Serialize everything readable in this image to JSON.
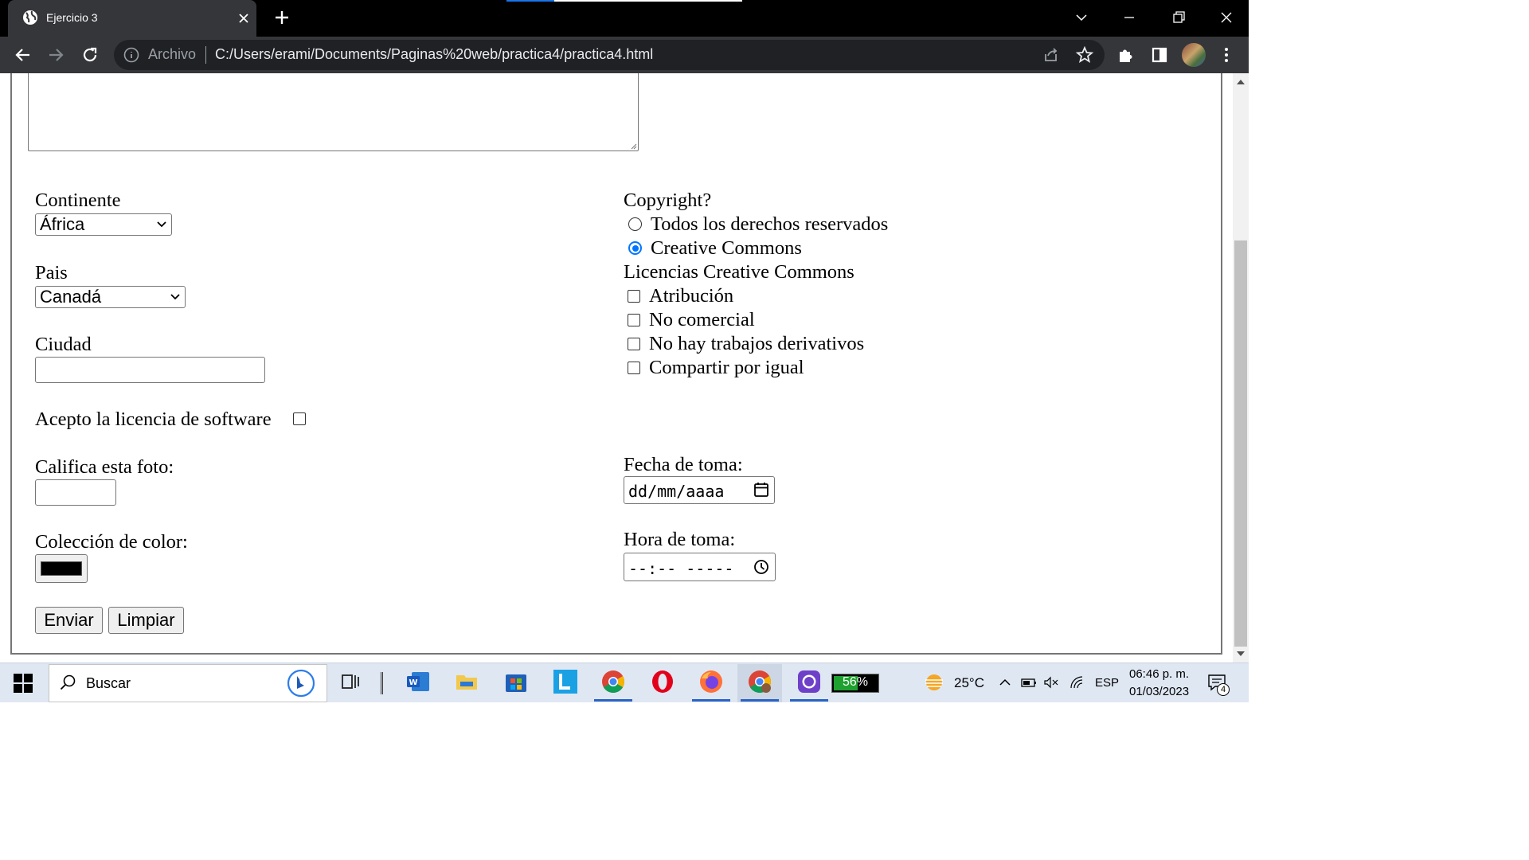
{
  "browser": {
    "tab_title": "Ejercicio 3",
    "scheme_label": "Archivo",
    "url": "C:/Users/erami/Documents/Paginas%20web/practica4/practica4.html"
  },
  "form": {
    "continente": {
      "label": "Continente",
      "selected": "África"
    },
    "pais": {
      "label": "Pais",
      "selected": "Canadá"
    },
    "ciudad": {
      "label": "Ciudad",
      "value": ""
    },
    "licencia_software": {
      "label": "Acepto la licencia de software",
      "checked": false
    },
    "calificacion": {
      "label": "Califica esta foto:",
      "value": ""
    },
    "color": {
      "label": "Colección de color:",
      "value": "#000000"
    },
    "copyright": {
      "label": "Copyright?",
      "options": [
        {
          "label": "Todos los derechos reservados",
          "selected": false
        },
        {
          "label": "Creative Commons",
          "selected": true
        }
      ]
    },
    "licencias_cc": {
      "label": "Licencias Creative Commons",
      "options": [
        {
          "label": "Atribución",
          "checked": false
        },
        {
          "label": "No comercial",
          "checked": false
        },
        {
          "label": "No hay trabajos derivativos",
          "checked": false
        },
        {
          "label": "Compartir por igual",
          "checked": false
        }
      ]
    },
    "fecha": {
      "label": "Fecha de toma:",
      "placeholder": "dd/mm/aaaa"
    },
    "hora": {
      "label": "Hora de toma:",
      "placeholder": "--:-- -----"
    },
    "buttons": {
      "submit": "Enviar",
      "reset": "Limpiar"
    }
  },
  "taskbar": {
    "search_placeholder": "Buscar",
    "battery_percent": "56%",
    "weather_temp": "25°C",
    "language": "ESP",
    "time": "06:46 p. m.",
    "date": "01/03/2023",
    "notification_count": "4",
    "apps": [
      "task-view",
      "word",
      "file-explorer",
      "microsoft-store",
      "lens-app",
      "chrome",
      "opera",
      "firefox",
      "chrome-profile",
      "github-desktop"
    ]
  },
  "colors": {
    "accent": "#0075ff",
    "chrome_dark": "#35363a",
    "taskbar": "#dfe7f3"
  }
}
